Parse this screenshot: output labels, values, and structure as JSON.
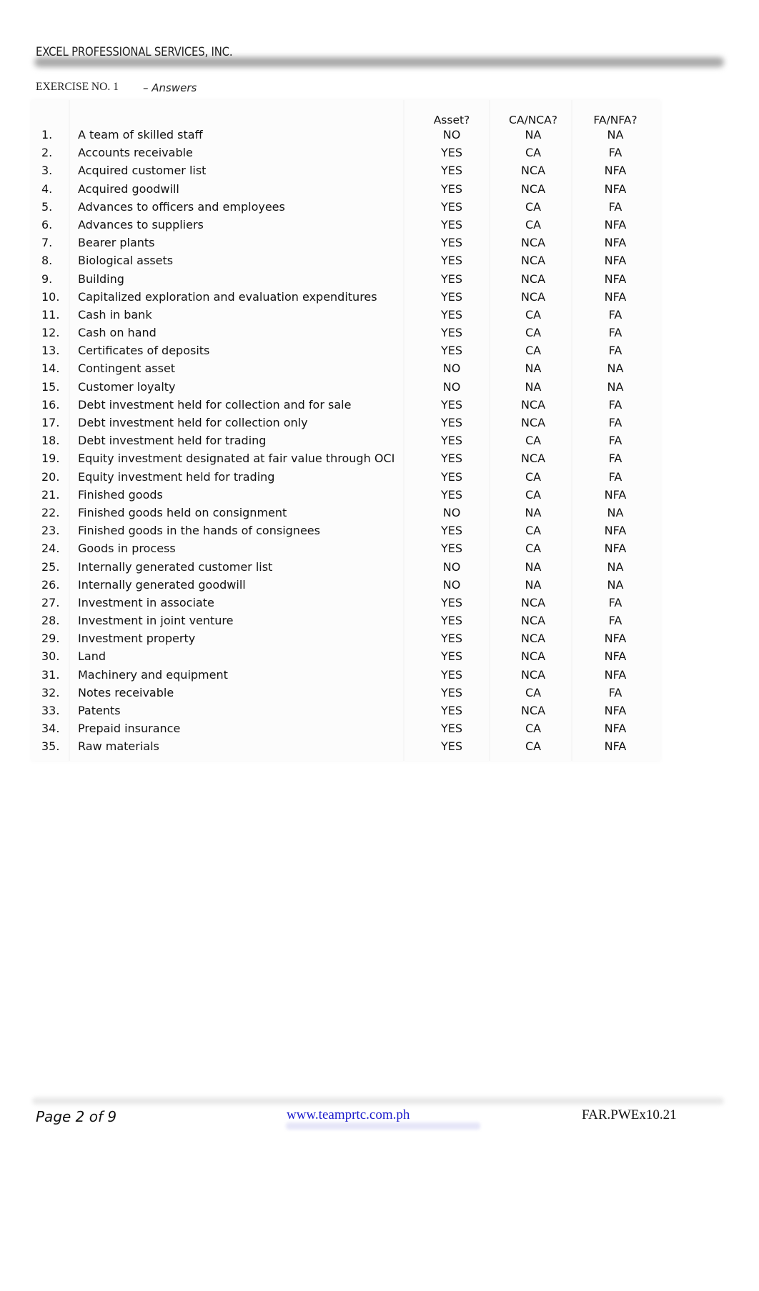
{
  "header": {
    "company": "EXCEL PROFESSIONAL SERVICES, INC.",
    "exercise": "EXERCISE NO. 1",
    "subtitle": "– Answers"
  },
  "table": {
    "columns": [
      "Asset?",
      "CA/NCA?",
      "FA/NFA?"
    ],
    "rows": [
      {
        "num": "1.",
        "item": "A team of skilled staff",
        "asset": "NO",
        "ca": "NA",
        "fa": "NA"
      },
      {
        "num": "2.",
        "item": "Accounts receivable",
        "asset": "YES",
        "ca": "CA",
        "fa": "FA"
      },
      {
        "num": "3.",
        "item": "Acquired customer list",
        "asset": "YES",
        "ca": "NCA",
        "fa": "NFA"
      },
      {
        "num": "4.",
        "item": "Acquired goodwill",
        "asset": "YES",
        "ca": "NCA",
        "fa": "NFA"
      },
      {
        "num": "5.",
        "item": "Advances to officers and employees",
        "asset": "YES",
        "ca": "CA",
        "fa": "FA"
      },
      {
        "num": "6.",
        "item": "Advances to suppliers",
        "asset": "YES",
        "ca": "CA",
        "fa": "NFA"
      },
      {
        "num": "7.",
        "item": "Bearer plants",
        "asset": "YES",
        "ca": "NCA",
        "fa": "NFA"
      },
      {
        "num": "8.",
        "item": "Biological assets",
        "asset": "YES",
        "ca": "NCA",
        "fa": "NFA"
      },
      {
        "num": "9.",
        "item": "Building",
        "asset": "YES",
        "ca": "NCA",
        "fa": "NFA"
      },
      {
        "num": "10.",
        "item": "Capitalized exploration and evaluation expenditures",
        "asset": "YES",
        "ca": "NCA",
        "fa": "NFA"
      },
      {
        "num": "11.",
        "item": "Cash in bank",
        "asset": "YES",
        "ca": "CA",
        "fa": "FA"
      },
      {
        "num": "12.",
        "item": "Cash on hand",
        "asset": "YES",
        "ca": "CA",
        "fa": "FA"
      },
      {
        "num": "13.",
        "item": "Certificates of deposits",
        "asset": "YES",
        "ca": "CA",
        "fa": "FA"
      },
      {
        "num": "14.",
        "item": "Contingent asset",
        "asset": "NO",
        "ca": "NA",
        "fa": "NA"
      },
      {
        "num": "15.",
        "item": "Customer loyalty",
        "asset": "NO",
        "ca": "NA",
        "fa": "NA"
      },
      {
        "num": "16.",
        "item": "Debt investment held for collection and for sale",
        "asset": "YES",
        "ca": "NCA",
        "fa": "FA"
      },
      {
        "num": "17.",
        "item": "Debt investment held for collection only",
        "asset": "YES",
        "ca": "NCA",
        "fa": "FA"
      },
      {
        "num": "18.",
        "item": "Debt investment held for trading",
        "asset": "YES",
        "ca": "CA",
        "fa": "FA"
      },
      {
        "num": "19.",
        "item": "Equity investment designated at fair value through OCI",
        "asset": "YES",
        "ca": "NCA",
        "fa": "FA"
      },
      {
        "num": "20.",
        "item": "Equity investment held for trading",
        "asset": "YES",
        "ca": "CA",
        "fa": "FA"
      },
      {
        "num": "21.",
        "item": "Finished goods",
        "asset": "YES",
        "ca": "CA",
        "fa": "NFA"
      },
      {
        "num": "22.",
        "item": "Finished goods held on consignment",
        "asset": "NO",
        "ca": "NA",
        "fa": "NA"
      },
      {
        "num": "23.",
        "item": "Finished goods in the hands of consignees",
        "asset": "YES",
        "ca": "CA",
        "fa": "NFA"
      },
      {
        "num": "24.",
        "item": "Goods in process",
        "asset": "YES",
        "ca": "CA",
        "fa": "NFA"
      },
      {
        "num": "25.",
        "item": "Internally generated customer list",
        "asset": "NO",
        "ca": "NA",
        "fa": "NA"
      },
      {
        "num": "26.",
        "item": "Internally generated goodwill",
        "asset": "NO",
        "ca": "NA",
        "fa": "NA"
      },
      {
        "num": "27.",
        "item": "Investment in associate",
        "asset": "YES",
        "ca": "NCA",
        "fa": "FA"
      },
      {
        "num": "28.",
        "item": "Investment in joint venture",
        "asset": "YES",
        "ca": "NCA",
        "fa": "FA"
      },
      {
        "num": "29.",
        "item": "Investment property",
        "asset": "YES",
        "ca": "NCA",
        "fa": "NFA"
      },
      {
        "num": "30.",
        "item": "Land",
        "asset": "YES",
        "ca": "NCA",
        "fa": "NFA"
      },
      {
        "num": "31.",
        "item": "Machinery and equipment",
        "asset": "YES",
        "ca": "NCA",
        "fa": "NFA"
      },
      {
        "num": "32.",
        "item": "Notes receivable",
        "asset": "YES",
        "ca": "CA",
        "fa": "FA"
      },
      {
        "num": "33.",
        "item": "Patents",
        "asset": "YES",
        "ca": "NCA",
        "fa": "NFA"
      },
      {
        "num": "34.",
        "item": "Prepaid insurance",
        "asset": "YES",
        "ca": "CA",
        "fa": "NFA"
      },
      {
        "num": "35.",
        "item": "Raw materials",
        "asset": "YES",
        "ca": "CA",
        "fa": "NFA"
      }
    ]
  },
  "footer": {
    "page": "Page 2 of 9",
    "website": "www.teamprtc.com.ph",
    "code": "FAR.PWEx10.21",
    "link_color": "#1a1acc"
  }
}
